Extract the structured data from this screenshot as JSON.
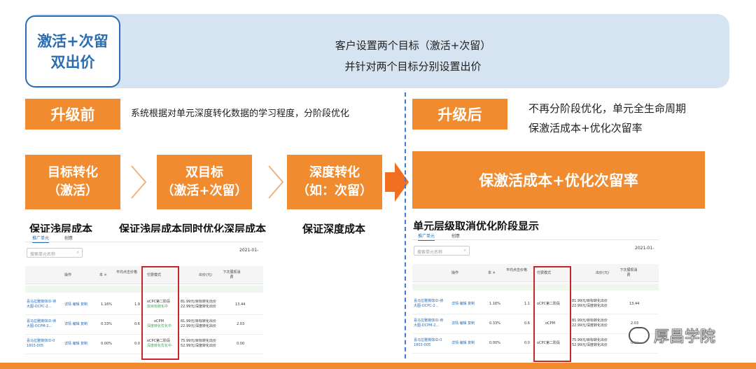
{
  "title": {
    "line1": "激活+次留",
    "line2": "双出价"
  },
  "banner": {
    "line1": "客户设置两个目标（激活+次留）",
    "line2": "并针对两个目标分别设置出价"
  },
  "before": {
    "tag": "升级前",
    "desc": "系统根据对单元深度转化数据的学习程度，分阶段优化",
    "stages": [
      {
        "line1": "目标转化",
        "line2": "（激活）",
        "caption": "保证浅层成本"
      },
      {
        "line1": "双目标",
        "line2": "（激活+次留）",
        "caption": "保证浅层成本同时优化深层成本"
      },
      {
        "line1": "深度转化",
        "line2": "（如：次留）",
        "caption": "保证深度成本"
      }
    ]
  },
  "after": {
    "tag": "升级后",
    "desc1": "不再分阶段优化，单元全生命周期",
    "desc2": "保激活成本+优化次留率",
    "big": "保激活成本+优化次留率",
    "caption": "单元层级取消优化阶段显示"
  },
  "shot_left": {
    "tab1": "推广单元",
    "tab2": "创意",
    "search": "搜索单元名称",
    "date": "2021-01-",
    "headers": [
      "操作",
      "本 ≑",
      "平均点击价格",
      "付费模式",
      "出价(元)",
      "下次展现消费"
    ],
    "rows": [
      {
        "name1": "喜马拉雅媒体ID-待",
        "name2": "大图-OCPC-2...",
        "ops": "详情 编辑 复制",
        "rate": "1.16%",
        "avg": "1.9",
        "mode1": "oCPC第二阶段",
        "mode2": "双目标转化中",
        "bid1": "81.99元/目标转化出价",
        "bid2": "22.99元/深度转化出价",
        "spend": "13.44"
      },
      {
        "name1": "喜马拉雅媒体ID-待",
        "name2": "大图-OCPM-2...",
        "ops": "详情 编辑 复制",
        "rate": "0.33%",
        "avg": "0.6",
        "mode1": "oCPM",
        "mode2": "深度转化优化中",
        "bid1": "81.99元/目标转化出价",
        "bid2": "22.99元/深度转化出价",
        "spend": "2.03"
      },
      {
        "name1": "喜马拉雅媒体ID-0",
        "name2": "1803-005",
        "ops": "详情 编辑 复制",
        "rate": "0.00%",
        "avg": "0.0",
        "mode1": "oCPC第二阶段",
        "mode2": "深度转化优化中",
        "bid1": "75.99元/目标转化出价",
        "bid2": "52.99元/深度转化出价",
        "spend": "0.00"
      }
    ]
  },
  "shot_right": {
    "tab1": "推广单元",
    "tab2": "创意",
    "search": "搜索单元名称",
    "date": "2021-01-",
    "headers": [
      "操作",
      "本 ≑",
      "平均点击价格",
      "付费模式",
      "出价(元)",
      "下次展现消费"
    ],
    "rows": [
      {
        "name1": "喜马拉雅媒体ID-待",
        "name2": "大图-OCPC-2...",
        "ops": "详情 编辑 复制",
        "rate": "1.16%",
        "avg": "1.1",
        "mode1": "oCPC第二阶段",
        "bid1": "81.99元/目标转化出价",
        "bid2": "22.99元/深度转化出价",
        "spend": "13.44"
      },
      {
        "name1": "喜马拉雅媒体ID-待",
        "name2": "大图-DCPM-2...",
        "ops": "详情 编辑 复制",
        "rate": "0.33%",
        "avg": "0.6",
        "mode1": "oCPM",
        "bid1": "81.99元/目标转化出价",
        "bid2": "22.99元/深度转化出价",
        "spend": "2.03"
      },
      {
        "name1": "喜马拉雅媒体ID-0",
        "name2": "1803-005",
        "ops": "详情 编辑 复制",
        "rate": "0.00%",
        "avg": "0.0",
        "mode1": "oCPC第二阶段",
        "bid1": "75.99元/目标转化出价",
        "bid2": "52.99元/深度转化出价",
        "spend": "0.00"
      }
    ]
  },
  "watermark": "厚昌学院",
  "colors": {
    "orange": "#f08c2f",
    "blue": "#2a6db1",
    "banner": "#d6e3f0",
    "red": "#c8252c"
  }
}
